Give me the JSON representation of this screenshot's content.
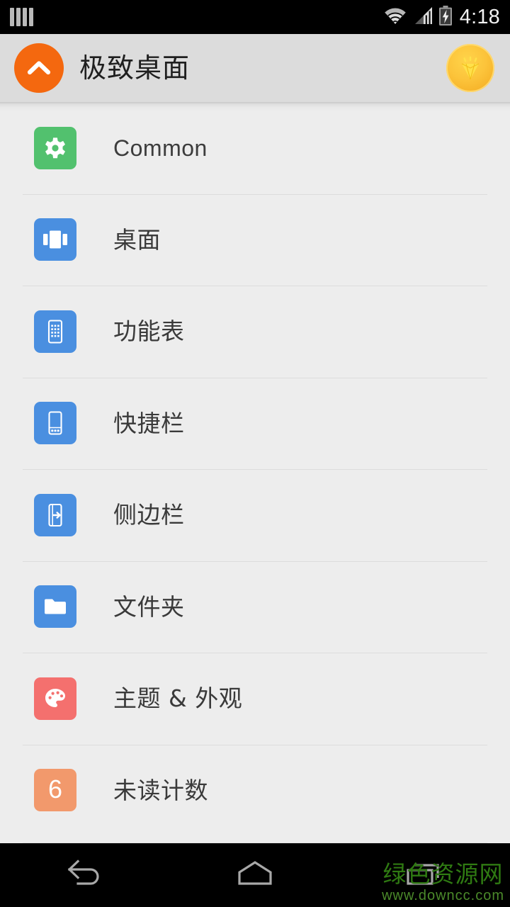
{
  "statusbar": {
    "notification_icon": "signal-bars-icon",
    "wifi_icon": "wifi-icon",
    "cell_signal_icon": "cell-signal-icon",
    "battery_icon": "battery-charging-icon",
    "clock": "4:18"
  },
  "header": {
    "logo_icon": "chevron-up-circle-icon",
    "logo_color": "#f4680f",
    "title": "极致桌面",
    "premium_icon": "gem-badge-icon",
    "premium_color": "#f7bf2c",
    "background": "#dcdcdc"
  },
  "list": {
    "items": [
      {
        "label": "Common",
        "script": "latin",
        "icon": "gear-icon",
        "icon_color": "#52c16e",
        "name": "list-item-common"
      },
      {
        "label": "桌面",
        "script": "cjk",
        "icon": "home-screens-icon",
        "icon_color": "#4a8fe0",
        "name": "list-item-desktop"
      },
      {
        "label": "功能表",
        "script": "cjk",
        "icon": "app-drawer-icon",
        "icon_color": "#4a8fe0",
        "name": "list-item-app-drawer"
      },
      {
        "label": "快捷栏",
        "script": "cjk",
        "icon": "dock-bar-icon",
        "icon_color": "#4a8fe0",
        "name": "list-item-dock"
      },
      {
        "label": "侧边栏",
        "script": "cjk",
        "icon": "sidebar-icon",
        "icon_color": "#4a8fe0",
        "name": "list-item-sidebar"
      },
      {
        "label": "文件夹",
        "script": "cjk",
        "icon": "folder-icon",
        "icon_color": "#4a8fe0",
        "name": "list-item-folder"
      },
      {
        "label": "主题 & 外观",
        "script": "cjk",
        "icon": "palette-icon",
        "icon_color": "#f4706e",
        "name": "list-item-theme-appearance"
      },
      {
        "label": "未读计数",
        "script": "cjk",
        "icon": "unread-count-badge-icon",
        "icon_color": "#f2996c",
        "badge_value": "6",
        "name": "list-item-unread-count"
      }
    ]
  },
  "navbar": {
    "back_icon": "back-arrow-icon",
    "home_icon": "home-icon",
    "recents_icon": "recent-apps-icon"
  },
  "watermark": {
    "site_name": "绿色资源网",
    "url": "www.downcc.com",
    "color": "#2f7a12"
  }
}
